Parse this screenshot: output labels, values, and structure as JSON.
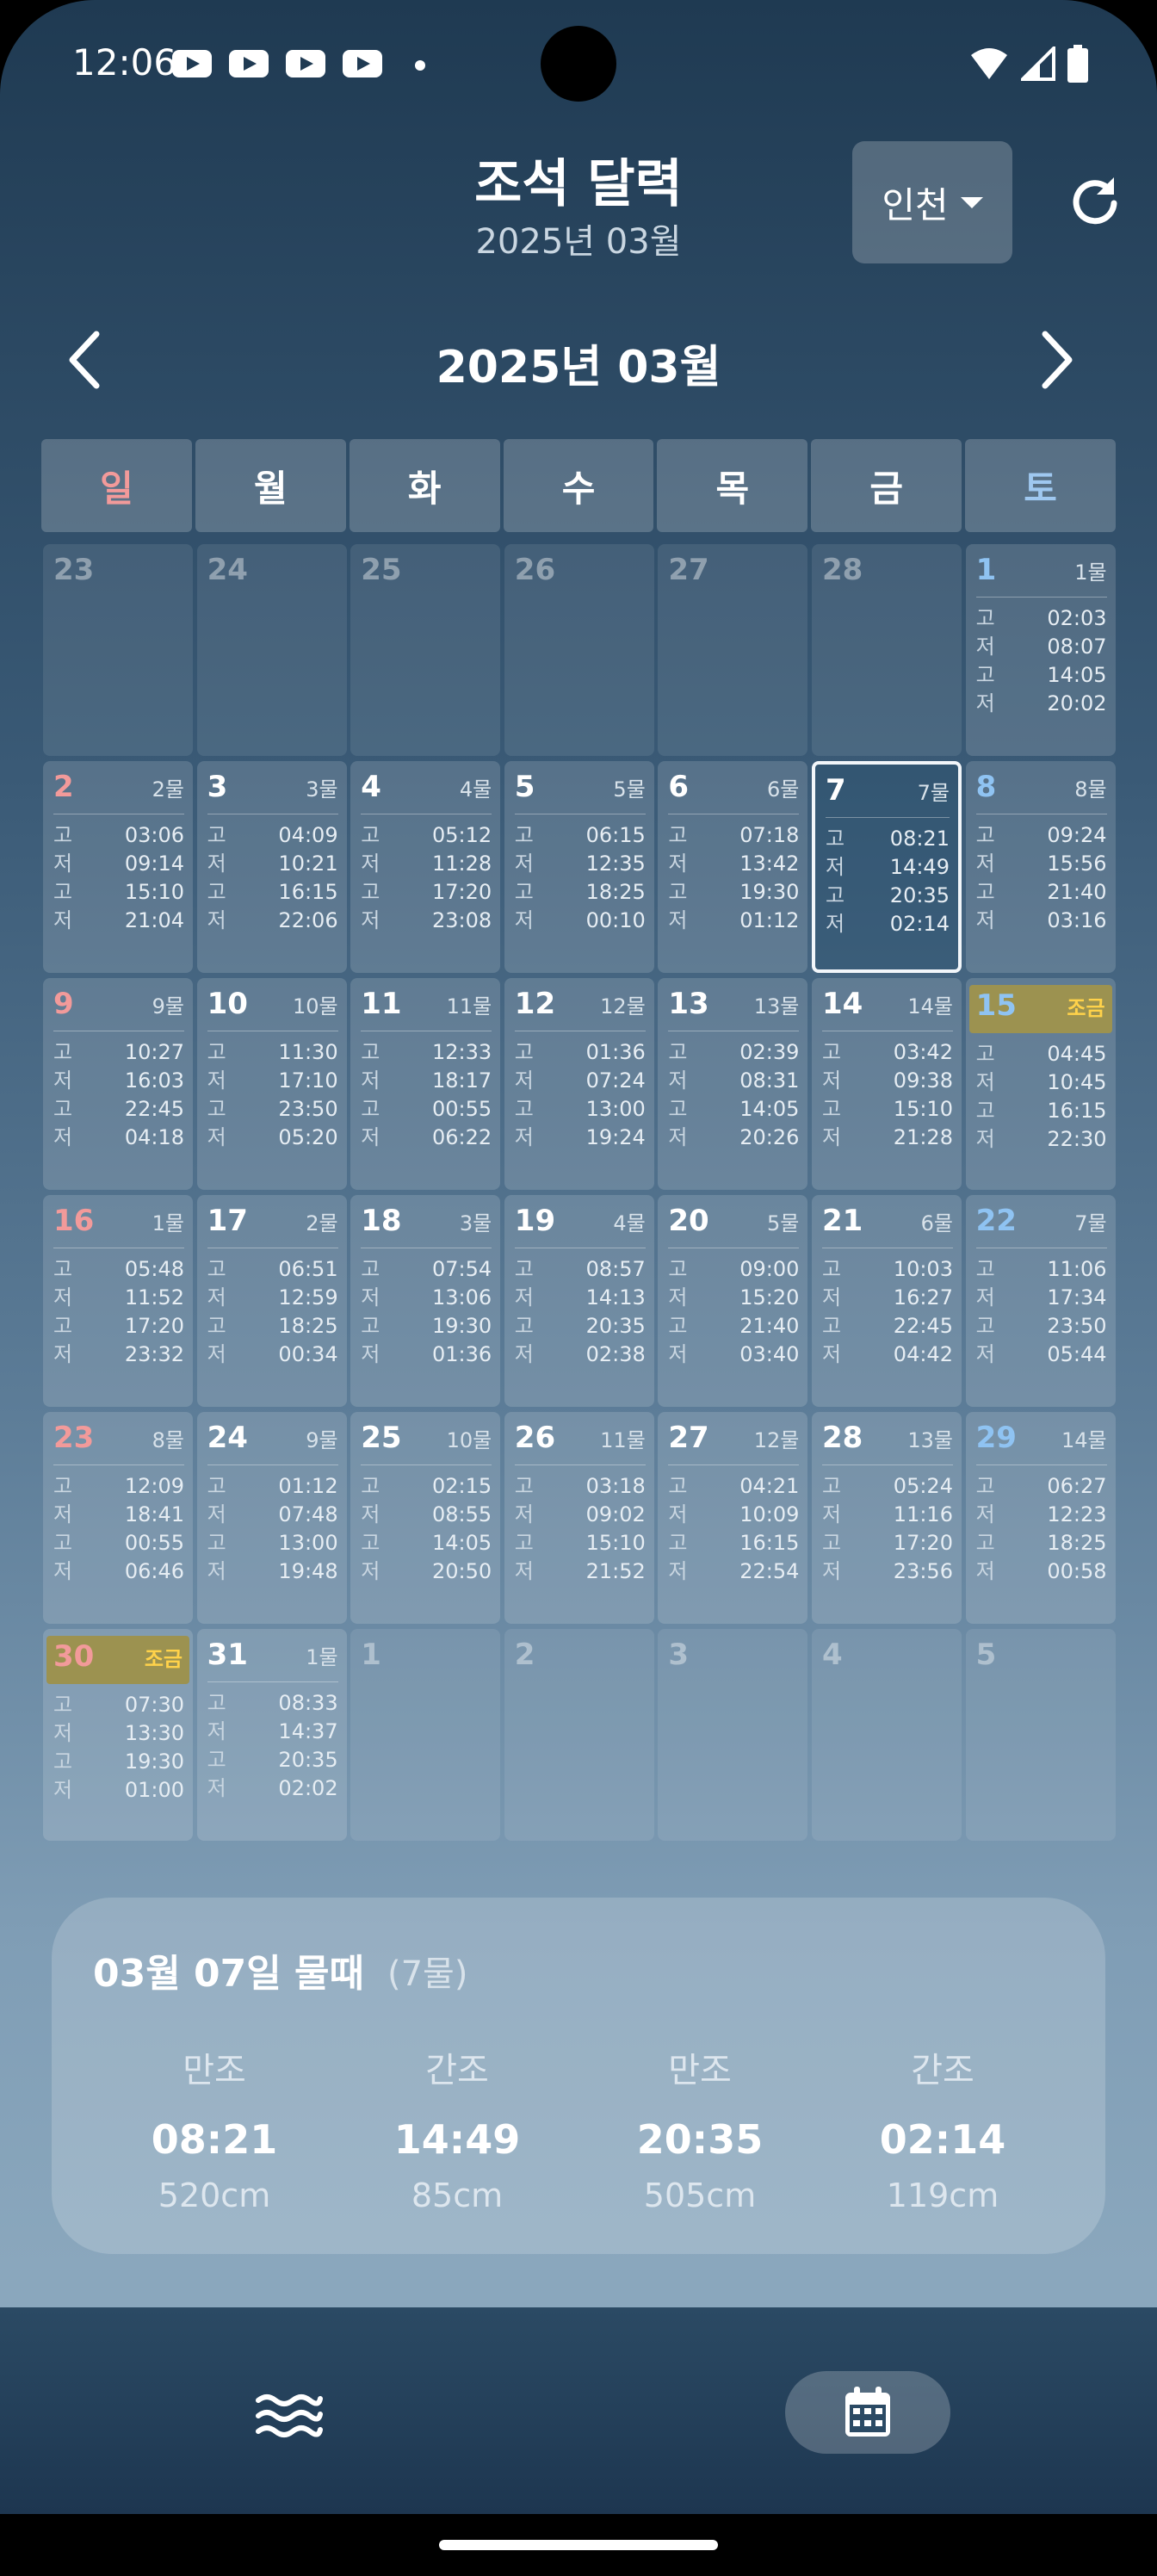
{
  "status_bar": {
    "time": "12:06"
  },
  "header": {
    "title": "조석 달력",
    "subtitle": "2025년 03월",
    "region": "인천"
  },
  "nav": {
    "month_label": "2025년 03월"
  },
  "weekdays": [
    "일",
    "월",
    "화",
    "수",
    "목",
    "금",
    "토"
  ],
  "calendar": {
    "days": [
      {
        "day": "23",
        "mul": "",
        "out": true
      },
      {
        "day": "24",
        "mul": "",
        "out": true
      },
      {
        "day": "25",
        "mul": "",
        "out": true
      },
      {
        "day": "26",
        "mul": "",
        "out": true
      },
      {
        "day": "27",
        "mul": "",
        "out": true
      },
      {
        "day": "28",
        "mul": "",
        "out": true
      },
      {
        "day": "1",
        "mul": "1물",
        "tides": [
          [
            "고",
            "02:03"
          ],
          [
            "저",
            "08:07"
          ],
          [
            "고",
            "14:05"
          ],
          [
            "저",
            "20:02"
          ]
        ]
      },
      {
        "day": "2",
        "mul": "2물",
        "tides": [
          [
            "고",
            "03:06"
          ],
          [
            "저",
            "09:14"
          ],
          [
            "고",
            "15:10"
          ],
          [
            "저",
            "21:04"
          ]
        ]
      },
      {
        "day": "3",
        "mul": "3물",
        "tides": [
          [
            "고",
            "04:09"
          ],
          [
            "저",
            "10:21"
          ],
          [
            "고",
            "16:15"
          ],
          [
            "저",
            "22:06"
          ]
        ]
      },
      {
        "day": "4",
        "mul": "4물",
        "tides": [
          [
            "고",
            "05:12"
          ],
          [
            "저",
            "11:28"
          ],
          [
            "고",
            "17:20"
          ],
          [
            "저",
            "23:08"
          ]
        ]
      },
      {
        "day": "5",
        "mul": "5물",
        "tides": [
          [
            "고",
            "06:15"
          ],
          [
            "저",
            "12:35"
          ],
          [
            "고",
            "18:25"
          ],
          [
            "저",
            "00:10"
          ]
        ]
      },
      {
        "day": "6",
        "mul": "6물",
        "tides": [
          [
            "고",
            "07:18"
          ],
          [
            "저",
            "13:42"
          ],
          [
            "고",
            "19:30"
          ],
          [
            "저",
            "01:12"
          ]
        ]
      },
      {
        "day": "7",
        "mul": "7물",
        "today": true,
        "tides": [
          [
            "고",
            "08:21"
          ],
          [
            "저",
            "14:49"
          ],
          [
            "고",
            "20:35"
          ],
          [
            "저",
            "02:14"
          ]
        ]
      },
      {
        "day": "8",
        "mul": "8물",
        "tides": [
          [
            "고",
            "09:24"
          ],
          [
            "저",
            "15:56"
          ],
          [
            "고",
            "21:40"
          ],
          [
            "저",
            "03:16"
          ]
        ]
      },
      {
        "day": "9",
        "mul": "9물",
        "tides": [
          [
            "고",
            "10:27"
          ],
          [
            "저",
            "16:03"
          ],
          [
            "고",
            "22:45"
          ],
          [
            "저",
            "04:18"
          ]
        ]
      },
      {
        "day": "10",
        "mul": "10물",
        "tides": [
          [
            "고",
            "11:30"
          ],
          [
            "저",
            "17:10"
          ],
          [
            "고",
            "23:50"
          ],
          [
            "저",
            "05:20"
          ]
        ]
      },
      {
        "day": "11",
        "mul": "11물",
        "tides": [
          [
            "고",
            "12:33"
          ],
          [
            "저",
            "18:17"
          ],
          [
            "고",
            "00:55"
          ],
          [
            "저",
            "06:22"
          ]
        ]
      },
      {
        "day": "12",
        "mul": "12물",
        "tides": [
          [
            "고",
            "01:36"
          ],
          [
            "저",
            "07:24"
          ],
          [
            "고",
            "13:00"
          ],
          [
            "저",
            "19:24"
          ]
        ]
      },
      {
        "day": "13",
        "mul": "13물",
        "tides": [
          [
            "고",
            "02:39"
          ],
          [
            "저",
            "08:31"
          ],
          [
            "고",
            "14:05"
          ],
          [
            "저",
            "20:26"
          ]
        ]
      },
      {
        "day": "14",
        "mul": "14물",
        "tides": [
          [
            "고",
            "03:42"
          ],
          [
            "저",
            "09:38"
          ],
          [
            "고",
            "15:10"
          ],
          [
            "저",
            "21:28"
          ]
        ]
      },
      {
        "day": "15",
        "mul": "조금",
        "jogeum": true,
        "tides": [
          [
            "고",
            "04:45"
          ],
          [
            "저",
            "10:45"
          ],
          [
            "고",
            "16:15"
          ],
          [
            "저",
            "22:30"
          ]
        ]
      },
      {
        "day": "16",
        "mul": "1물",
        "tides": [
          [
            "고",
            "05:48"
          ],
          [
            "저",
            "11:52"
          ],
          [
            "고",
            "17:20"
          ],
          [
            "저",
            "23:32"
          ]
        ]
      },
      {
        "day": "17",
        "mul": "2물",
        "tides": [
          [
            "고",
            "06:51"
          ],
          [
            "저",
            "12:59"
          ],
          [
            "고",
            "18:25"
          ],
          [
            "저",
            "00:34"
          ]
        ]
      },
      {
        "day": "18",
        "mul": "3물",
        "tides": [
          [
            "고",
            "07:54"
          ],
          [
            "저",
            "13:06"
          ],
          [
            "고",
            "19:30"
          ],
          [
            "저",
            "01:36"
          ]
        ]
      },
      {
        "day": "19",
        "mul": "4물",
        "tides": [
          [
            "고",
            "08:57"
          ],
          [
            "저",
            "14:13"
          ],
          [
            "고",
            "20:35"
          ],
          [
            "저",
            "02:38"
          ]
        ]
      },
      {
        "day": "20",
        "mul": "5물",
        "tides": [
          [
            "고",
            "09:00"
          ],
          [
            "저",
            "15:20"
          ],
          [
            "고",
            "21:40"
          ],
          [
            "저",
            "03:40"
          ]
        ]
      },
      {
        "day": "21",
        "mul": "6물",
        "tides": [
          [
            "고",
            "10:03"
          ],
          [
            "저",
            "16:27"
          ],
          [
            "고",
            "22:45"
          ],
          [
            "저",
            "04:42"
          ]
        ]
      },
      {
        "day": "22",
        "mul": "7물",
        "tides": [
          [
            "고",
            "11:06"
          ],
          [
            "저",
            "17:34"
          ],
          [
            "고",
            "23:50"
          ],
          [
            "저",
            "05:44"
          ]
        ]
      },
      {
        "day": "23",
        "mul": "8물",
        "tides": [
          [
            "고",
            "12:09"
          ],
          [
            "저",
            "18:41"
          ],
          [
            "고",
            "00:55"
          ],
          [
            "저",
            "06:46"
          ]
        ]
      },
      {
        "day": "24",
        "mul": "9물",
        "tides": [
          [
            "고",
            "01:12"
          ],
          [
            "저",
            "07:48"
          ],
          [
            "고",
            "13:00"
          ],
          [
            "저",
            "19:48"
          ]
        ]
      },
      {
        "day": "25",
        "mul": "10물",
        "tides": [
          [
            "고",
            "02:15"
          ],
          [
            "저",
            "08:55"
          ],
          [
            "고",
            "14:05"
          ],
          [
            "저",
            "20:50"
          ]
        ]
      },
      {
        "day": "26",
        "mul": "11물",
        "tides": [
          [
            "고",
            "03:18"
          ],
          [
            "저",
            "09:02"
          ],
          [
            "고",
            "15:10"
          ],
          [
            "저",
            "21:52"
          ]
        ]
      },
      {
        "day": "27",
        "mul": "12물",
        "tides": [
          [
            "고",
            "04:21"
          ],
          [
            "저",
            "10:09"
          ],
          [
            "고",
            "16:15"
          ],
          [
            "저",
            "22:54"
          ]
        ]
      },
      {
        "day": "28",
        "mul": "13물",
        "tides": [
          [
            "고",
            "05:24"
          ],
          [
            "저",
            "11:16"
          ],
          [
            "고",
            "17:20"
          ],
          [
            "저",
            "23:56"
          ]
        ]
      },
      {
        "day": "29",
        "mul": "14물",
        "tides": [
          [
            "고",
            "06:27"
          ],
          [
            "저",
            "12:23"
          ],
          [
            "고",
            "18:25"
          ],
          [
            "저",
            "00:58"
          ]
        ]
      },
      {
        "day": "30",
        "mul": "조금",
        "jogeum": true,
        "tides": [
          [
            "고",
            "07:30"
          ],
          [
            "저",
            "13:30"
          ],
          [
            "고",
            "19:30"
          ],
          [
            "저",
            "01:00"
          ]
        ]
      },
      {
        "day": "31",
        "mul": "1물",
        "tides": [
          [
            "고",
            "08:33"
          ],
          [
            "저",
            "14:37"
          ],
          [
            "고",
            "20:35"
          ],
          [
            "저",
            "02:02"
          ]
        ]
      },
      {
        "day": "1",
        "mul": "",
        "out": true
      },
      {
        "day": "2",
        "mul": "",
        "out": true
      },
      {
        "day": "3",
        "mul": "",
        "out": true
      },
      {
        "day": "4",
        "mul": "",
        "out": true
      },
      {
        "day": "5",
        "mul": "",
        "out": true
      }
    ]
  },
  "detail": {
    "title": "03월 07일 물때",
    "sub": "(7물)",
    "entries": [
      {
        "label": "만조",
        "time": "08:21",
        "height": "520cm"
      },
      {
        "label": "간조",
        "time": "14:49",
        "height": "85cm"
      },
      {
        "label": "만조",
        "time": "20:35",
        "height": "505cm"
      },
      {
        "label": "간조",
        "time": "02:14",
        "height": "119cm"
      }
    ]
  }
}
